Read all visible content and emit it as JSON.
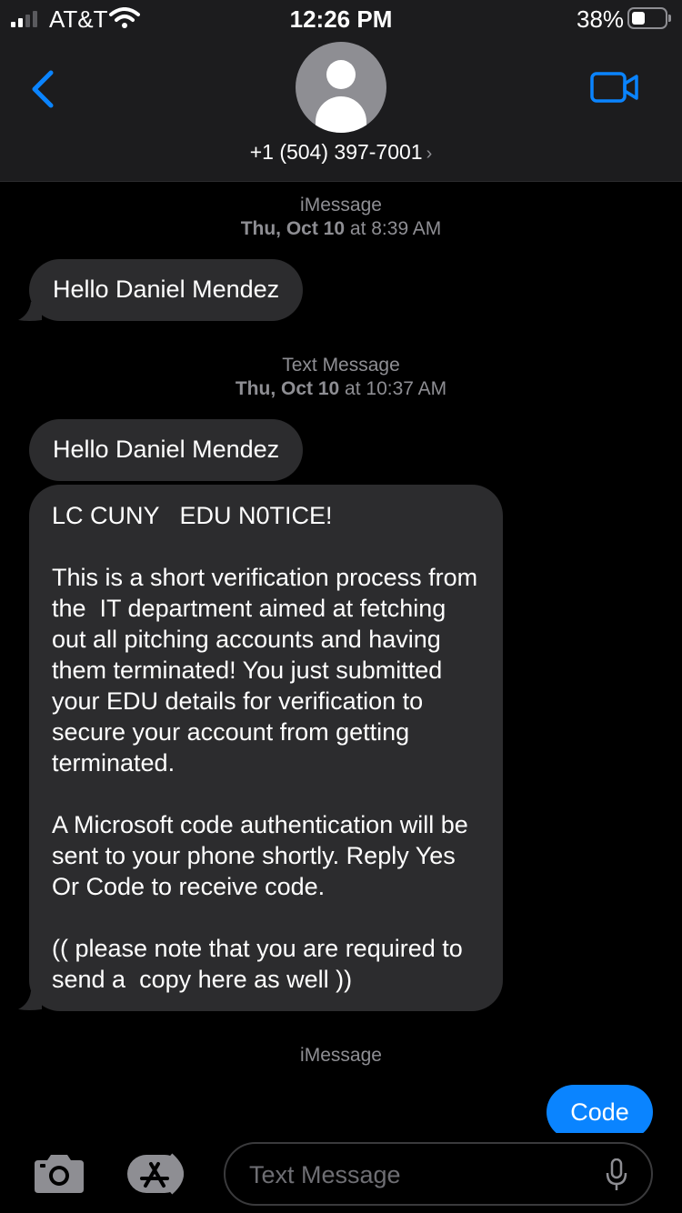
{
  "status_bar": {
    "carrier": "AT&T",
    "time": "12:26 PM",
    "battery_percent": "38%",
    "battery_level": 0.38,
    "signal_bars": 2
  },
  "header": {
    "contact": "+1 (504) 397-7001",
    "chevron": "›",
    "icons": {
      "back": "chevron-left-icon",
      "video": "video-camera-icon",
      "avatar": "person-icon"
    },
    "accent_color": "#0a84ff"
  },
  "messages": {
    "meta1": {
      "label": "iMessage",
      "date": "Thu, Oct 10",
      "at": "at",
      "time": "8:39 AM"
    },
    "msg1": "Hello Daniel Mendez",
    "meta2": {
      "label": "Text Message",
      "date": "Thu, Oct 10",
      "at": "at",
      "time": "10:37 AM"
    },
    "msg2": "Hello Daniel Mendez",
    "msg3": "LC CUNY   EDU N0TICE!\n\nThis is a short verification process from the  IT department aimed at fetching out all pitching accounts and having them terminated! You just submitted your EDU details for verification to secure your account from getting terminated.\n\nA Microsoft code authentication will be sent to your phone shortly. Reply Yes Or Code to receive code.\n\n(( please note that you are required to send a  copy here as well ))",
    "meta3": {
      "label": "iMessage"
    },
    "sent1": "Code"
  },
  "input_bar": {
    "placeholder": "Text Message",
    "icons": {
      "camera": "camera-icon",
      "apps": "app-store-icon",
      "mic": "microphone-icon"
    }
  }
}
